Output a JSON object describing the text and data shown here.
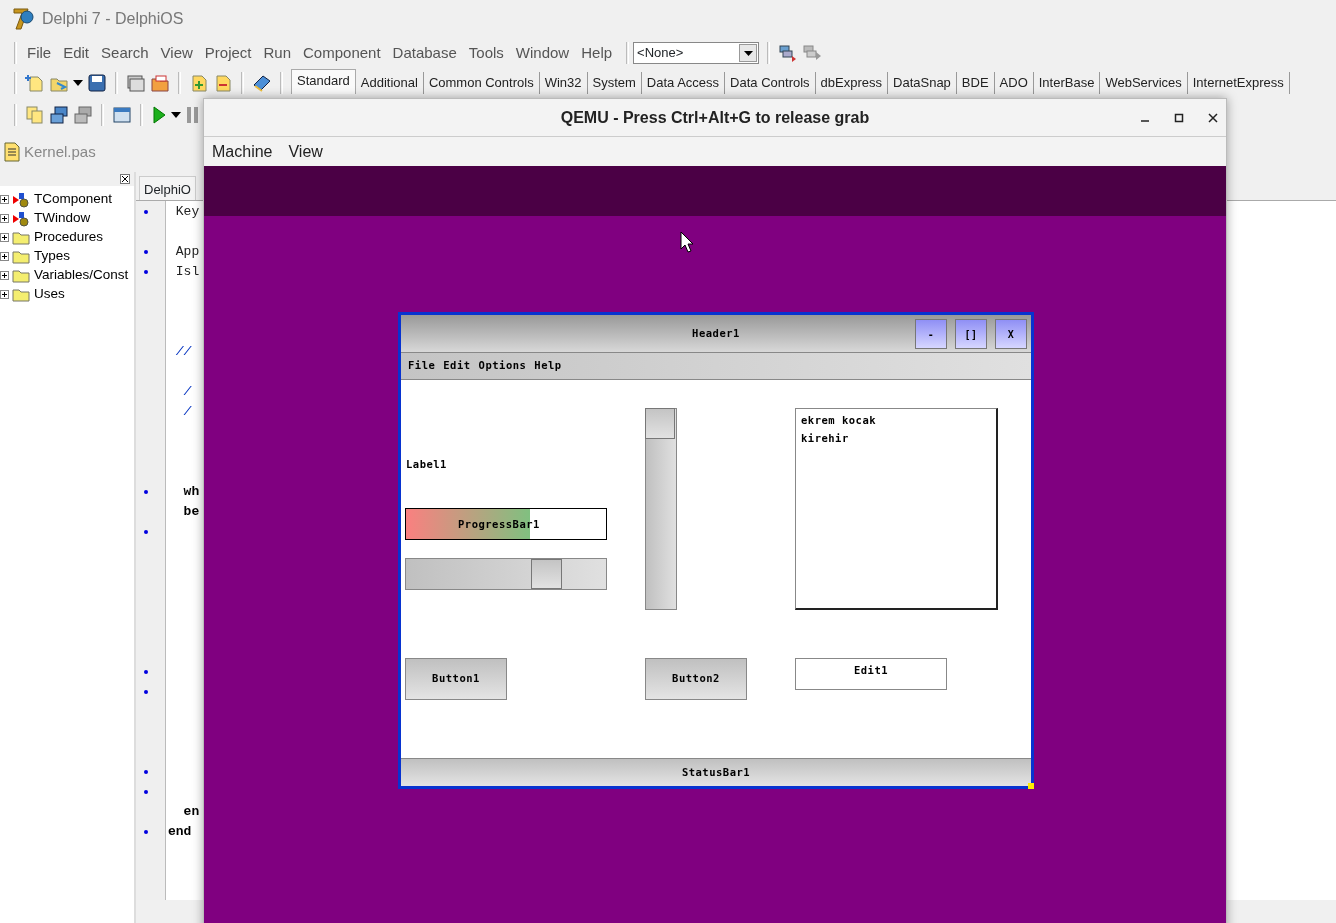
{
  "ide": {
    "title": "Delphi 7 - DelphiOS",
    "menu": [
      "File",
      "Edit",
      "Search",
      "View",
      "Project",
      "Run",
      "Component",
      "Database",
      "Tools",
      "Window",
      "Help"
    ],
    "component_combo": {
      "value": "<None>"
    },
    "palette_tabs": [
      {
        "label": "Standard",
        "selected": true
      },
      {
        "label": "Additional",
        "selected": false
      },
      {
        "label": "Common Controls",
        "selected": false
      },
      {
        "label": "Win32",
        "selected": false
      },
      {
        "label": "System",
        "selected": false
      },
      {
        "label": "Data Access",
        "selected": false
      },
      {
        "label": "Data Controls",
        "selected": false
      },
      {
        "label": "dbExpress",
        "selected": false
      },
      {
        "label": "DataSnap",
        "selected": false
      },
      {
        "label": "BDE",
        "selected": false
      },
      {
        "label": "ADO",
        "selected": false
      },
      {
        "label": "InterBase",
        "selected": false
      },
      {
        "label": "WebServices",
        "selected": false
      },
      {
        "label": "InternetExpress",
        "selected": false
      }
    ],
    "file_tab": "Kernel.pas",
    "tree": [
      {
        "label": "TComponent",
        "kind": "class"
      },
      {
        "label": "TWindow",
        "kind": "class"
      },
      {
        "label": "Procedures",
        "kind": "folder"
      },
      {
        "label": "Types",
        "kind": "folder"
      },
      {
        "label": "Variables/Const",
        "kind": "folder"
      },
      {
        "label": "Uses",
        "kind": "folder"
      }
    ],
    "editor_tab": "DelphiO",
    "code_lines": [
      {
        "text": " Key",
        "kind": "code",
        "dot": true
      },
      {
        "dot": false
      },
      {
        "text": " App",
        "kind": "code",
        "dot": true
      },
      {
        "text": " Isl",
        "kind": "code",
        "dot": true
      },
      {
        "dot": false
      },
      {
        "dot": false
      },
      {
        "dot": false
      },
      {
        "text": " //",
        "kind": "comment",
        "dot": false
      },
      {
        "dot": false
      },
      {
        "text": "  /",
        "kind": "comment",
        "dot": false
      },
      {
        "text": "  /",
        "kind": "comment",
        "dot": false
      },
      {
        "dot": false
      },
      {
        "dot": false
      },
      {
        "dot": false
      },
      {
        "text": "  wh",
        "kind": "keyword",
        "dot": true
      },
      {
        "text": "  be",
        "kind": "keyword",
        "dot": false
      },
      {
        "dot": true
      },
      {
        "dot": false
      },
      {
        "dot": false
      },
      {
        "dot": false
      },
      {
        "dot": false
      },
      {
        "dot": false
      },
      {
        "dot": false
      },
      {
        "dot": true
      },
      {
        "dot": true
      },
      {
        "dot": false
      },
      {
        "dot": false
      },
      {
        "dot": false
      },
      {
        "dot": true
      },
      {
        "dot": true
      },
      {
        "text": "  en",
        "kind": "keyword",
        "dot": false
      },
      {
        "text": "end",
        "kind": "keyword",
        "dot": true
      }
    ]
  },
  "qemu": {
    "title": "QEMU - Press Ctrl+Alt+G to release grab",
    "menu": [
      "Machine",
      "View"
    ],
    "guest": {
      "title": "Header1",
      "title_buttons": [
        "-",
        "[]",
        "X"
      ],
      "menu": [
        "File",
        "Edit",
        "Options",
        "Help"
      ],
      "label": "Label1",
      "progress": {
        "label": "ProgressBar1",
        "level": 0.62
      },
      "trackbar": {
        "level": 0.74
      },
      "listbox": [
        "ekrem kocak",
        "kirehir"
      ],
      "buttons": [
        "Button1",
        "Button2"
      ],
      "edit": {
        "value": "Edit1"
      },
      "status": "StatusBar1"
    }
  }
}
